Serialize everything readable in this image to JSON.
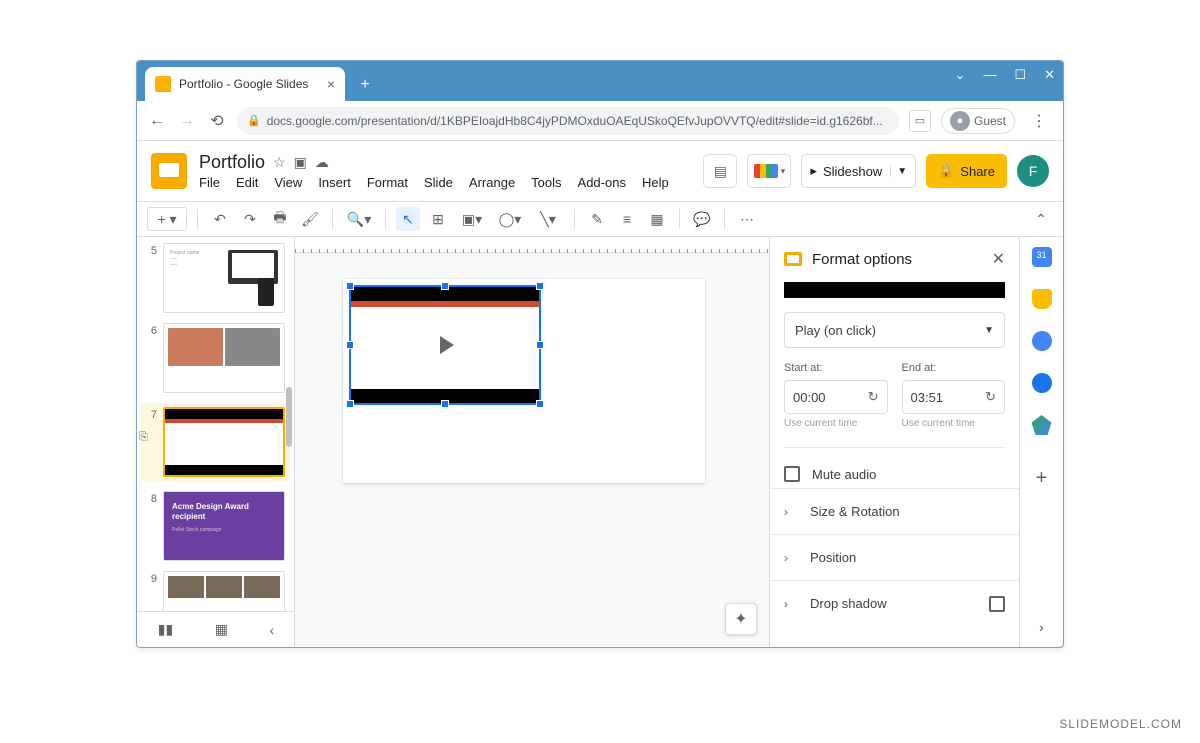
{
  "watermark": "SLIDEMODEL.COM",
  "browser": {
    "tab_title": "Portfolio - Google Slides",
    "url": "docs.google.com/presentation/d/1KBPEIoajdHb8C4jyPDMOxduOAEqUSkoQEfvJupOVVTQ/edit#slide=id.g1626bf...",
    "guest_label": "Guest"
  },
  "app": {
    "doc_title": "Portfolio",
    "menus": [
      "File",
      "Edit",
      "View",
      "Insert",
      "Format",
      "Slide",
      "Arrange",
      "Tools",
      "Add-ons",
      "Help"
    ],
    "slideshow_label": "Slideshow",
    "share_label": "Share",
    "profile_initial": "F"
  },
  "filmstrip": {
    "slides": [
      {
        "num": "5"
      },
      {
        "num": "6"
      },
      {
        "num": "7"
      },
      {
        "num": "8"
      },
      {
        "num": "9"
      }
    ],
    "slide8_title": "Acme Design Award recipient",
    "slide8_sub": "Pellet Stock campaign"
  },
  "format_panel": {
    "title": "Format options",
    "play_mode": "Play (on click)",
    "start_label": "Start at:",
    "end_label": "End at:",
    "start_value": "00:00",
    "end_value": "03:51",
    "current_time_hint": "Use current time",
    "mute_label": "Mute audio",
    "sections": [
      "Size & Rotation",
      "Position",
      "Drop shadow"
    ]
  }
}
